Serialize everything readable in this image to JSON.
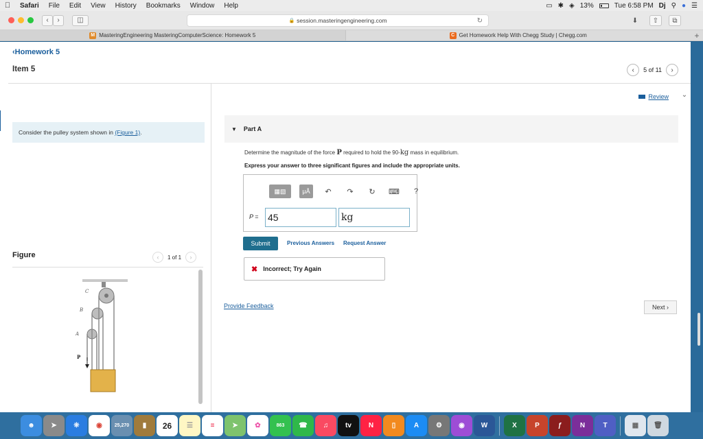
{
  "menubar": {
    "items": [
      "Safari",
      "File",
      "Edit",
      "View",
      "History",
      "Bookmarks",
      "Window",
      "Help"
    ],
    "battery": "13%",
    "clock": "Tue 6:58 PM",
    "user": "Dj"
  },
  "toolbar": {
    "url": "session.masteringengineering.com"
  },
  "tabs": [
    {
      "label": "MasteringEngineering MasteringComputerScience: Homework 5",
      "active": true
    },
    {
      "label": "Get Homework Help With Chegg Study | Chegg.com",
      "active": false
    }
  ],
  "header": {
    "back_link": "Homework 5",
    "item_title": "Item 5",
    "pager": "5 of 11",
    "review": "Review"
  },
  "left": {
    "problem_text": "Consider the pulley system shown in",
    "problem_link": "(Figure 1)",
    "problem_end": ".",
    "figure_label": "Figure",
    "figure_pager": "1 of 1",
    "figure_labels": [
      "C",
      "B",
      "A",
      "P"
    ]
  },
  "part": {
    "title": "Part A",
    "question_prefix": "Determine the magnitude of the force",
    "question_force": "P",
    "question_mid": "required to hold the 90-",
    "question_unit": "kg",
    "question_end": "mass in equilibrium.",
    "instruction": "Express your answer to three significant figures and include the appropriate units.",
    "toolbar_tools": [
      "templates-icon",
      "micro-a-icon",
      "undo-icon",
      "redo-icon",
      "reset-icon",
      "keyboard-icon",
      "help-icon"
    ],
    "toolbar_help": "?",
    "micro_label": "μÅ",
    "variable_label": "P =",
    "value": "45",
    "unit": "kg",
    "submit": "Submit",
    "previous_answers": "Previous Answers",
    "request_answer": "Request Answer",
    "result": "Incorrect; Try Again",
    "feedback": "Provide Feedback",
    "next": "Next"
  },
  "dock": {
    "badges": {
      "photos": "25,270",
      "calendar_day": "26",
      "mail_count": "863"
    },
    "apps": [
      "finder",
      "launchpad",
      "safari",
      "chrome",
      "preview",
      "notes-folder",
      "calendar",
      "notes",
      "reminders",
      "maps",
      "photos",
      "messages",
      "facetime",
      "music",
      "tv",
      "news",
      "books",
      "app-store",
      "system-preferences",
      "podcasts",
      "word",
      "excel",
      "powerpoint",
      "terminal",
      "onenote",
      "teams",
      "downloads",
      "trash"
    ]
  }
}
